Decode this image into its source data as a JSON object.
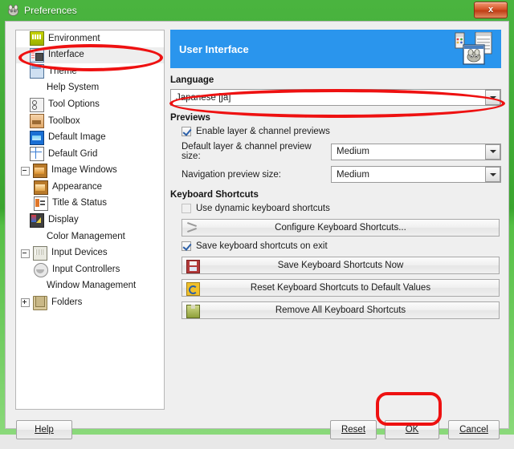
{
  "window": {
    "title": "Preferences",
    "app_icon": "gimp-wilber-icon",
    "close_label": "x",
    "accent_green": "#3ba52f",
    "accent_blue": "#2a95ed",
    "annotation_color": "#ee1111"
  },
  "sidebar": {
    "items": [
      {
        "label": "Environment",
        "icon": "environment-icon",
        "indent": 0,
        "expander": "none",
        "selected": false
      },
      {
        "label": "Interface",
        "icon": "interface-icon",
        "indent": 0,
        "expander": "none",
        "selected": true
      },
      {
        "label": "Theme",
        "icon": "theme-icon",
        "indent": 0,
        "expander": "none",
        "selected": false
      },
      {
        "label": "Help System",
        "icon": "help-system-icon",
        "indent": 0,
        "expander": "none",
        "selected": false
      },
      {
        "label": "Tool Options",
        "icon": "tool-options-icon",
        "indent": 0,
        "expander": "none",
        "selected": false
      },
      {
        "label": "Toolbox",
        "icon": "toolbox-icon",
        "indent": 0,
        "expander": "none",
        "selected": false
      },
      {
        "label": "Default Image",
        "icon": "default-image-icon",
        "indent": 0,
        "expander": "none",
        "selected": false
      },
      {
        "label": "Default Grid",
        "icon": "default-grid-icon",
        "indent": 0,
        "expander": "none",
        "selected": false
      },
      {
        "label": "Image Windows",
        "icon": "image-windows-icon",
        "indent": 0,
        "expander": "expanded",
        "selected": false
      },
      {
        "label": "Appearance",
        "icon": "appearance-icon",
        "indent": 1,
        "expander": "none",
        "selected": false
      },
      {
        "label": "Title & Status",
        "icon": "title-status-icon",
        "indent": 1,
        "expander": "none",
        "selected": false
      },
      {
        "label": "Display",
        "icon": "display-icon",
        "indent": 0,
        "expander": "none",
        "selected": false
      },
      {
        "label": "Color Management",
        "icon": "color-management-icon",
        "indent": 0,
        "expander": "none",
        "selected": false
      },
      {
        "label": "Input Devices",
        "icon": "input-devices-icon",
        "indent": 0,
        "expander": "expanded",
        "selected": false
      },
      {
        "label": "Input Controllers",
        "icon": "input-controllers-icon",
        "indent": 1,
        "expander": "none",
        "selected": false
      },
      {
        "label": "Window Management",
        "icon": "window-management-icon",
        "indent": 0,
        "expander": "none",
        "selected": false
      },
      {
        "label": "Folders",
        "icon": "folders-icon",
        "indent": 0,
        "expander": "collapsed",
        "selected": false
      }
    ]
  },
  "main": {
    "header_title": "User Interface",
    "header_icon": "user-interface-graphic",
    "language": {
      "group_title": "Language",
      "selected": "Japanese [ja]"
    },
    "previews": {
      "group_title": "Previews",
      "enable_checkbox": {
        "label": "Enable layer & channel previews",
        "checked": true
      },
      "default_size": {
        "label": "Default layer & channel preview size:",
        "value": "Medium"
      },
      "navigation_size": {
        "label": "Navigation preview size:",
        "value": "Medium"
      }
    },
    "keyboard_shortcuts": {
      "group_title": "Keyboard Shortcuts",
      "use_dynamic": {
        "label": "Use dynamic keyboard shortcuts",
        "checked": false
      },
      "configure_button": {
        "label": "Configure Keyboard Shortcuts...",
        "icon": "configure-shortcuts-icon"
      },
      "save_on_exit": {
        "label": "Save keyboard shortcuts on exit",
        "checked": true
      },
      "save_now_button": {
        "label": "Save Keyboard Shortcuts Now",
        "icon": "save-icon"
      },
      "reset_button": {
        "label": "Reset Keyboard Shortcuts to Default Values",
        "icon": "reset-icon"
      },
      "remove_button": {
        "label": "Remove All Keyboard Shortcuts",
        "icon": "remove-icon"
      }
    }
  },
  "footer": {
    "help": "Help",
    "reset": "Reset",
    "ok": "OK",
    "cancel": "Cancel"
  }
}
